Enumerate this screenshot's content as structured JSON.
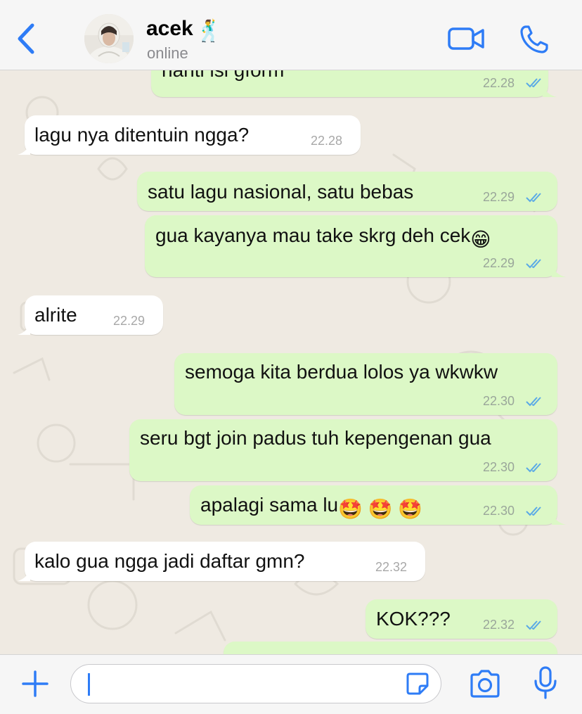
{
  "header": {
    "contact_name": "acek",
    "status": "online",
    "name_emoji": "🕺",
    "back_icon": "chevron-left-icon",
    "video_icon": "video-camera-icon",
    "call_icon": "phone-icon"
  },
  "messages": [
    {
      "dir": "out",
      "text": "nanti isi gform",
      "time": "22.28"
    },
    {
      "dir": "in",
      "text": "lagu nya ditentuin ngga?",
      "time": "22.28"
    },
    {
      "dir": "out",
      "text": "satu lagu nasional, satu bebas",
      "time": "22.29"
    },
    {
      "dir": "out",
      "text": "gua kayanya mau take skrg deh cek",
      "emoji": "😁",
      "time": "22.29"
    },
    {
      "dir": "in",
      "text": "alrite",
      "time": "22.29"
    },
    {
      "dir": "out",
      "text": "semoga kita berdua lolos ya wkwkw",
      "time": "22.30"
    },
    {
      "dir": "out",
      "text": "seru bgt join padus tuh kepengenan gua",
      "time": "22.30"
    },
    {
      "dir": "out",
      "text": "apalagi sama lu",
      "emoji": "🤩 🤩 🤩",
      "time": "22.30"
    },
    {
      "dir": "in",
      "text": "kalo gua ngga jadi daftar gmn?",
      "time": "22.32"
    },
    {
      "dir": "out",
      "text": "KOK???",
      "time": "22.32"
    }
  ],
  "composer": {
    "input_value": "",
    "plus_icon": "plus-icon",
    "sticker_icon": "sticker-icon",
    "camera_icon": "camera-icon",
    "mic_icon": "microphone-icon"
  },
  "colors": {
    "accent": "#2e7cf6",
    "outgoing_bubble": "#dcf8c6",
    "incoming_bubble": "#ffffff",
    "read_ticks": "#5aa9e6",
    "wallpaper": "#efeae2"
  }
}
